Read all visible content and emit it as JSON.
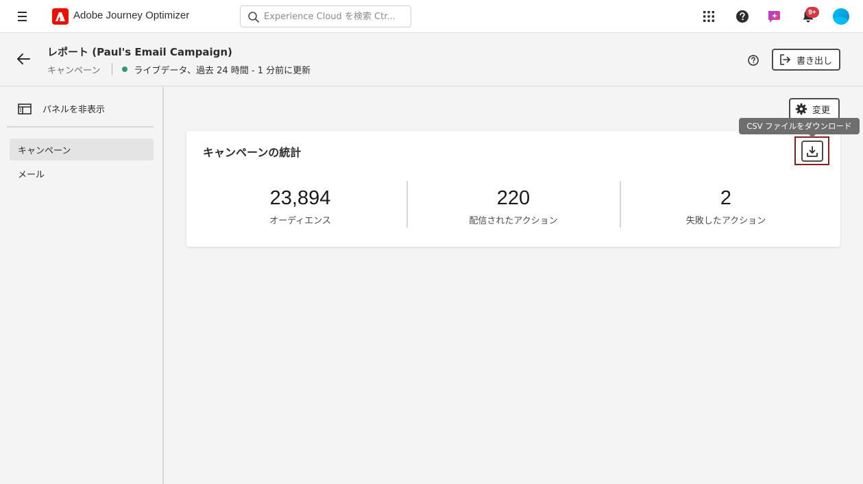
{
  "topbar": {
    "app_name": "Adobe Journey Optimizer",
    "search_placeholder": "Experience Cloud を検索 Ctr...",
    "notification_badge": "9+"
  },
  "header": {
    "title": "レポート (Paul's Email Campaign)",
    "breadcrumb": "キャンペーン",
    "live_status": "ライブデータ、過去 24 時間 - 1 分前に更新",
    "export_label": "書き出し"
  },
  "sidebar": {
    "hide_panel_label": "パネルを非表示",
    "items": [
      {
        "label": "キャンペーン",
        "selected": true
      },
      {
        "label": "メール",
        "selected": false
      }
    ]
  },
  "main": {
    "modify_label": "変更",
    "tooltip": "CSV ファイルをダウンロード",
    "card": {
      "title": "キャンペーンの統計",
      "metrics": [
        {
          "value": "23,894",
          "label": "オーディエンス"
        },
        {
          "value": "220",
          "label": "配信されたアクション"
        },
        {
          "value": "2",
          "label": "失敗したアクション"
        }
      ]
    }
  },
  "colors": {
    "brand_red": "#eb1000",
    "live_green": "#2d9d78",
    "badge_red": "#d7373f",
    "highlight_frame": "#8b1c1c"
  }
}
